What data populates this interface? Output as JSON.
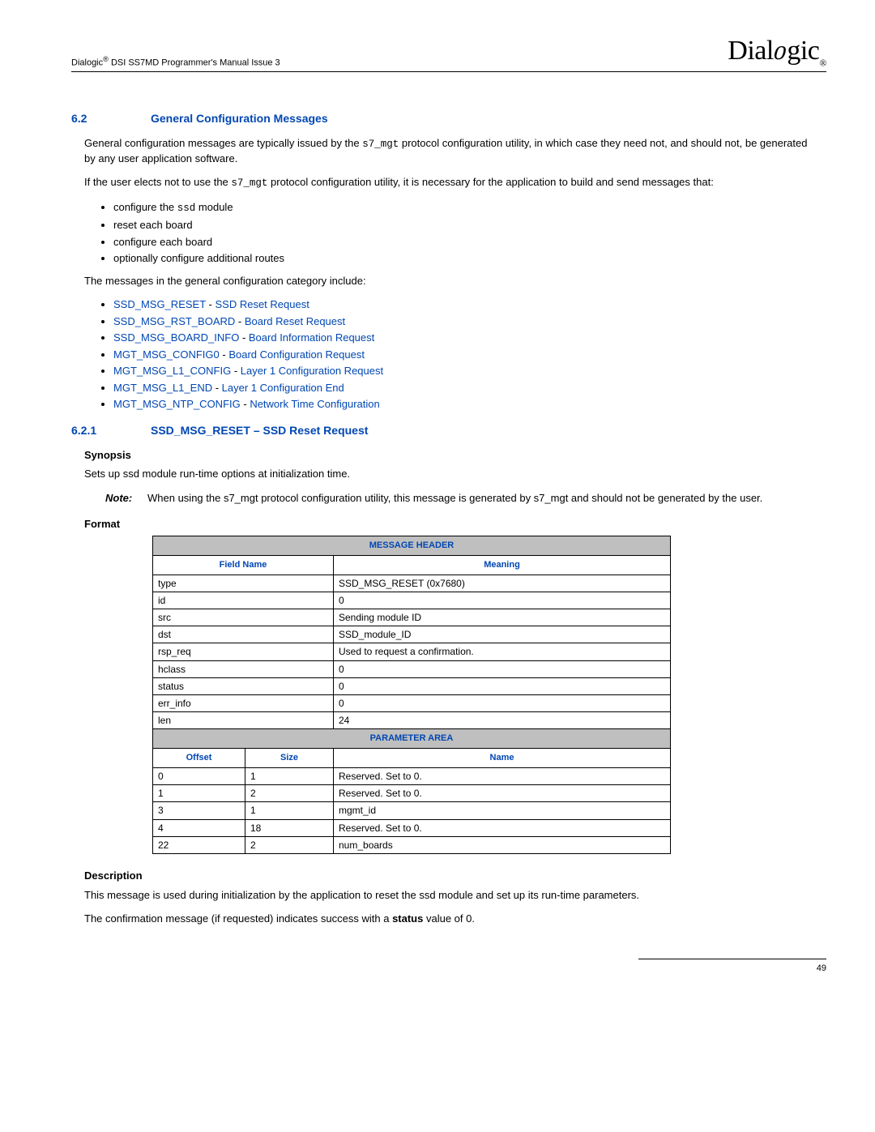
{
  "header": {
    "left_prefix": "Dialogic",
    "left_sup": "®",
    "left_rest": " DSI SS7MD Programmer's Manual  Issue 3",
    "logo_prefix": "Dial",
    "logo_mid": "o",
    "logo_suffix": "gic",
    "logo_reg": "®"
  },
  "sec62": {
    "num": "6.2",
    "title": "General Configuration Messages",
    "para1_a": "General configuration messages are typically issued by the ",
    "para1_code": "s7_mgt",
    "para1_b": " protocol configuration utility, in which case they need not, and should not, be generated by any user application software.",
    "para2_a": "If the user elects not to use the ",
    "para2_code": "s7_mgt",
    "para2_b": " protocol configuration utility, it is necessary for the application to build and send messages that:",
    "bullets1": [
      {
        "pre": "configure the ",
        "code": "ssd",
        "post": " module"
      },
      {
        "pre": "reset each board",
        "code": "",
        "post": ""
      },
      {
        "pre": "configure each board",
        "code": "",
        "post": ""
      },
      {
        "pre": "optionally configure additional routes",
        "code": "",
        "post": ""
      }
    ],
    "para3": "The messages in the general configuration category include:",
    "links": [
      {
        "a": "SSD_MSG_RESET",
        "b": "SSD Reset Request"
      },
      {
        "a": "SSD_MSG_RST_BOARD",
        "b": "Board Reset Request"
      },
      {
        "a": "SSD_MSG_BOARD_INFO",
        "b": "Board Information Request"
      },
      {
        "a": "MGT_MSG_CONFIG0",
        "b": "Board Configuration Request"
      },
      {
        "a": "MGT_MSG_L1_CONFIG",
        "b": "Layer 1 Configuration Request"
      },
      {
        "a": "MGT_MSG_L1_END",
        "b": "Layer 1 Configuration End"
      },
      {
        "a": "MGT_MSG_NTP_CONFIG",
        "b": "Network Time Configuration"
      }
    ]
  },
  "sec621": {
    "num": "6.2.1",
    "title": "SSD_MSG_RESET – SSD Reset Request",
    "synopsis_label": "Synopsis",
    "synopsis_text": "Sets up ssd module run-time options at initialization time.",
    "note_label": "Note:",
    "note_text": "When using the s7_mgt protocol configuration utility, this message is generated by s7_mgt and should not be generated by the user.",
    "format_label": "Format",
    "table": {
      "hdr1": "MESSAGE HEADER",
      "col_field": "Field Name",
      "col_meaning": "Meaning",
      "rows1": [
        {
          "f": "type",
          "m": "SSD_MSG_RESET (0x7680)"
        },
        {
          "f": "id",
          "m": "0"
        },
        {
          "f": "src",
          "m": "Sending module ID"
        },
        {
          "f": "dst",
          "m": "SSD_module_ID"
        },
        {
          "f": "rsp_req",
          "m": "Used to request a confirmation."
        },
        {
          "f": "hclass",
          "m": "0"
        },
        {
          "f": "status",
          "m": "0"
        },
        {
          "f": "err_info",
          "m": "0"
        },
        {
          "f": "len",
          "m": "24"
        }
      ],
      "hdr2": "PARAMETER AREA",
      "col_offset": "Offset",
      "col_size": "Size",
      "col_name": "Name",
      "rows2": [
        {
          "o": "0",
          "s": "1",
          "n": "Reserved. Set to 0."
        },
        {
          "o": "1",
          "s": "2",
          "n": "Reserved. Set to 0."
        },
        {
          "o": "3",
          "s": "1",
          "n": "mgmt_id"
        },
        {
          "o": "4",
          "s": "18",
          "n": "Reserved. Set to 0."
        },
        {
          "o": "22",
          "s": "2",
          "n": "num_boards"
        }
      ]
    },
    "desc_label": "Description",
    "desc_p1": "This message is used during initialization by the application to reset the ssd module and set up its run-time parameters.",
    "desc_p2_a": "The confirmation message (if requested) indicates success with a ",
    "desc_p2_bold": "status",
    "desc_p2_b": " value of 0."
  },
  "page_number": "49"
}
